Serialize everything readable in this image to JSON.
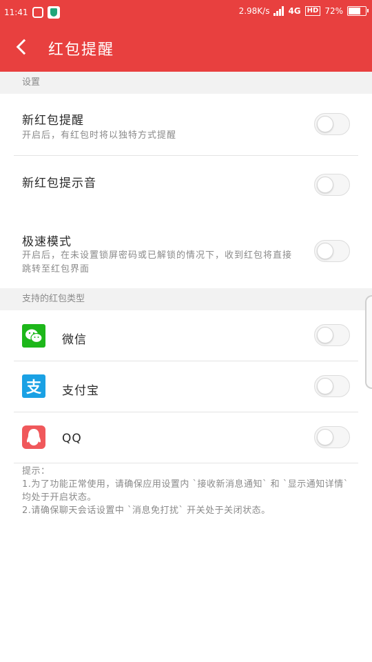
{
  "status_bar": {
    "time": "11:41",
    "net_speed": "2.98K/s",
    "network": "4G",
    "hd": "HD",
    "battery": "72%",
    "battery_level": 0.72
  },
  "header": {
    "title": "红包提醒",
    "bg_color": "#e8403f"
  },
  "sections": {
    "settings_label": "设置",
    "types_label": "支持的红包类型"
  },
  "settings": [
    {
      "title": "新红包提醒",
      "desc": "开启后，有红包时将以独特方式提醒",
      "on": false
    },
    {
      "title": "新红包提示音",
      "desc": "",
      "on": false
    },
    {
      "title": "极速模式",
      "desc": "开启后，在未设置锁屏密码或已解锁的情况下，收到红包将直接跳转至红包界面",
      "on": false
    }
  ],
  "apps": [
    {
      "name": "微信",
      "icon": "wechat-icon",
      "color": "#1db71a",
      "on": false
    },
    {
      "name": "支付宝",
      "icon": "alipay-icon",
      "glyph": "支",
      "color": "#1aa1e4",
      "on": false
    },
    {
      "name": "QQ",
      "icon": "qq-icon",
      "color": "#f0585b",
      "on": false
    }
  ],
  "tips": {
    "heading": "提示：",
    "line1": "1.为了功能正常使用，请确保应用设置内 `接收新消息通知` 和 `显示通知详情` 均处于开启状态。",
    "line2": "2.请确保聊天会话设置中 `消息免打扰` 开关处于关闭状态。"
  }
}
